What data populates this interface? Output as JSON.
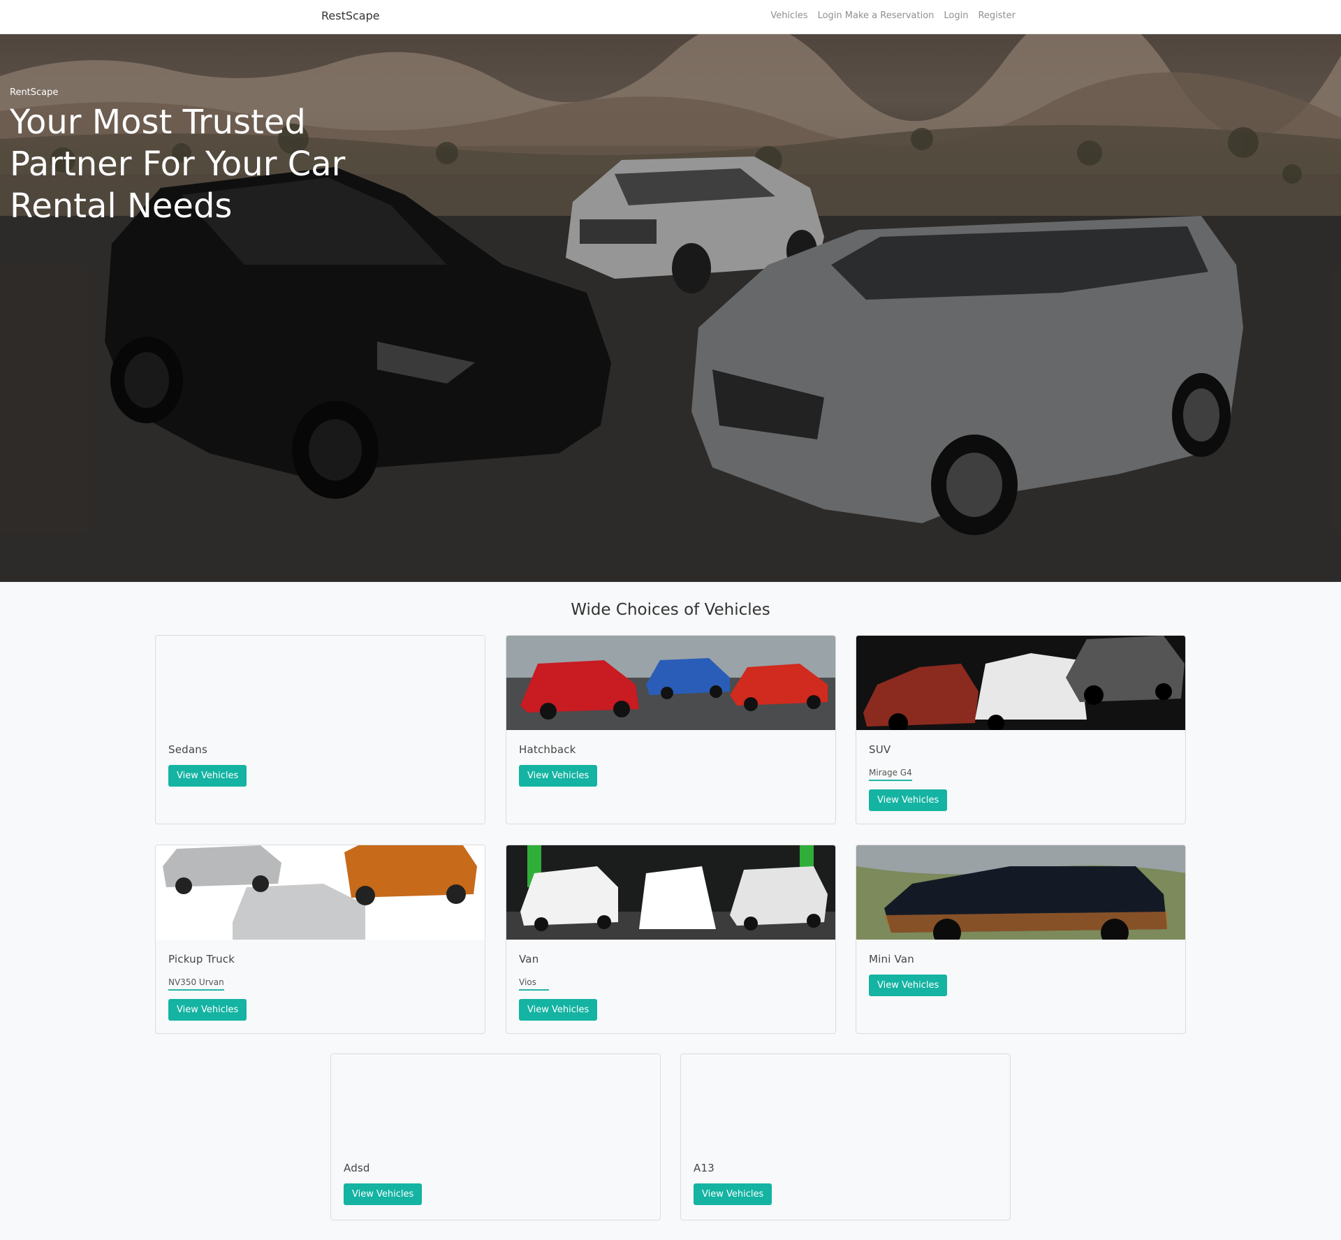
{
  "navbar": {
    "brand": "RestScape",
    "links": [
      "Vehicles",
      "Login Make a Reservation",
      "Login",
      "Register"
    ]
  },
  "hero": {
    "kicker": "RentScape",
    "title": "Your Most Trusted Partner For Your Car Rental Needs"
  },
  "section": {
    "title": "Wide Choices of Vehicles"
  },
  "cards": [
    {
      "title": "Sedans",
      "sub": "",
      "button": "View Vehicles"
    },
    {
      "title": "Hatchback",
      "sub": "",
      "button": "View Vehicles"
    },
    {
      "title": "SUV",
      "sub": "Mirage G4",
      "button": "View Vehicles"
    },
    {
      "title": "Pickup Truck",
      "sub": "NV350 Urvan",
      "button": "View Vehicles"
    },
    {
      "title": "Van",
      "sub": "Vios",
      "button": "View Vehicles"
    },
    {
      "title": "Mini Van",
      "sub": "",
      "button": "View Vehicles"
    },
    {
      "title": "Adsd",
      "sub": "",
      "button": "View Vehicles"
    },
    {
      "title": "A13",
      "sub": "",
      "button": "View Vehicles"
    }
  ],
  "colors": {
    "accent": "#14b3a2",
    "underline": "#1fb6a6"
  }
}
